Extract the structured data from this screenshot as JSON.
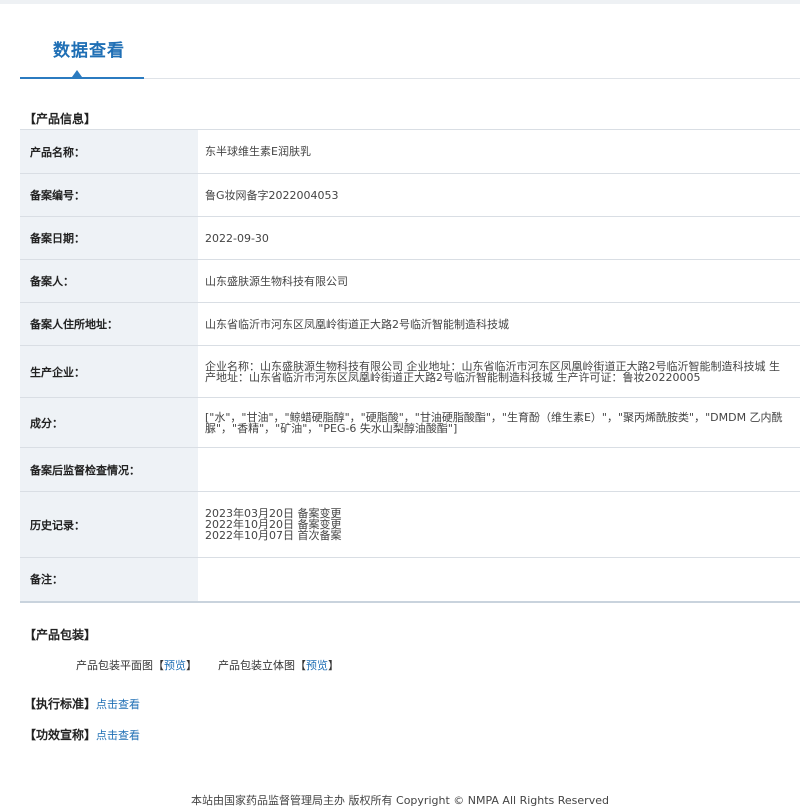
{
  "tab": {
    "title": "数据查看"
  },
  "product_info": {
    "heading": "【产品信息】",
    "rows": [
      {
        "label": "产品名称：",
        "value": "东半球维生素E润肤乳"
      },
      {
        "label": "备案编号：",
        "value": "鲁G妆网备字2022004053"
      },
      {
        "label": "备案日期：",
        "value": "2022-09-30"
      },
      {
        "label": "备案人：",
        "value": "山东盛肤源生物科技有限公司"
      },
      {
        "label": "备案人住所地址：",
        "value": "山东省临沂市河东区凤凰岭街道正大路2号临沂智能制造科技城"
      },
      {
        "label": "生产企业：",
        "value": "企业名称：山东盛肤源生物科技有限公司 企业地址：山东省临沂市河东区凤凰岭街道正大路2号临沂智能制造科技城 生产地址：山东省临沂市河东区凤凰岭街道正大路2号临沂智能制造科技城 生产许可证：鲁妆20220005"
      },
      {
        "label": "成分：",
        "value": "[\"水\"，\"甘油\"，\"鲸蜡硬脂醇\"，\"硬脂酸\"，\"甘油硬脂酸酯\"，\"生育酚（维生素E）\"，\"聚丙烯酰胺类\"，\"DMDM 乙内酰脲\"，\"香精\"，\"矿油\"，\"PEG-6 失水山梨醇油酸酯\"]"
      },
      {
        "label": "备案后监督检查情况：",
        "value": ""
      },
      {
        "label": "历史记录：",
        "history": [
          "2023年03月20日 备案变更",
          "2022年10月20日 备案变更",
          "2022年10月07日 首次备案"
        ]
      },
      {
        "label": "备注：",
        "value": ""
      }
    ]
  },
  "packaging": {
    "heading": "【产品包装】",
    "flat_label": "产品包装平面图",
    "stereo_label": "产品包装立体图",
    "bracket_open": "【",
    "bracket_close": "】",
    "preview_label": "预览"
  },
  "standard": {
    "heading": "【执行标准】",
    "link": "点击查看"
  },
  "efficacy": {
    "heading": "【功效宣称】",
    "link": "点击查看"
  },
  "footer": {
    "text": "本站由国家药品监督管理局主办 版权所有 Copyright © NMPA All Rights Reserved"
  }
}
